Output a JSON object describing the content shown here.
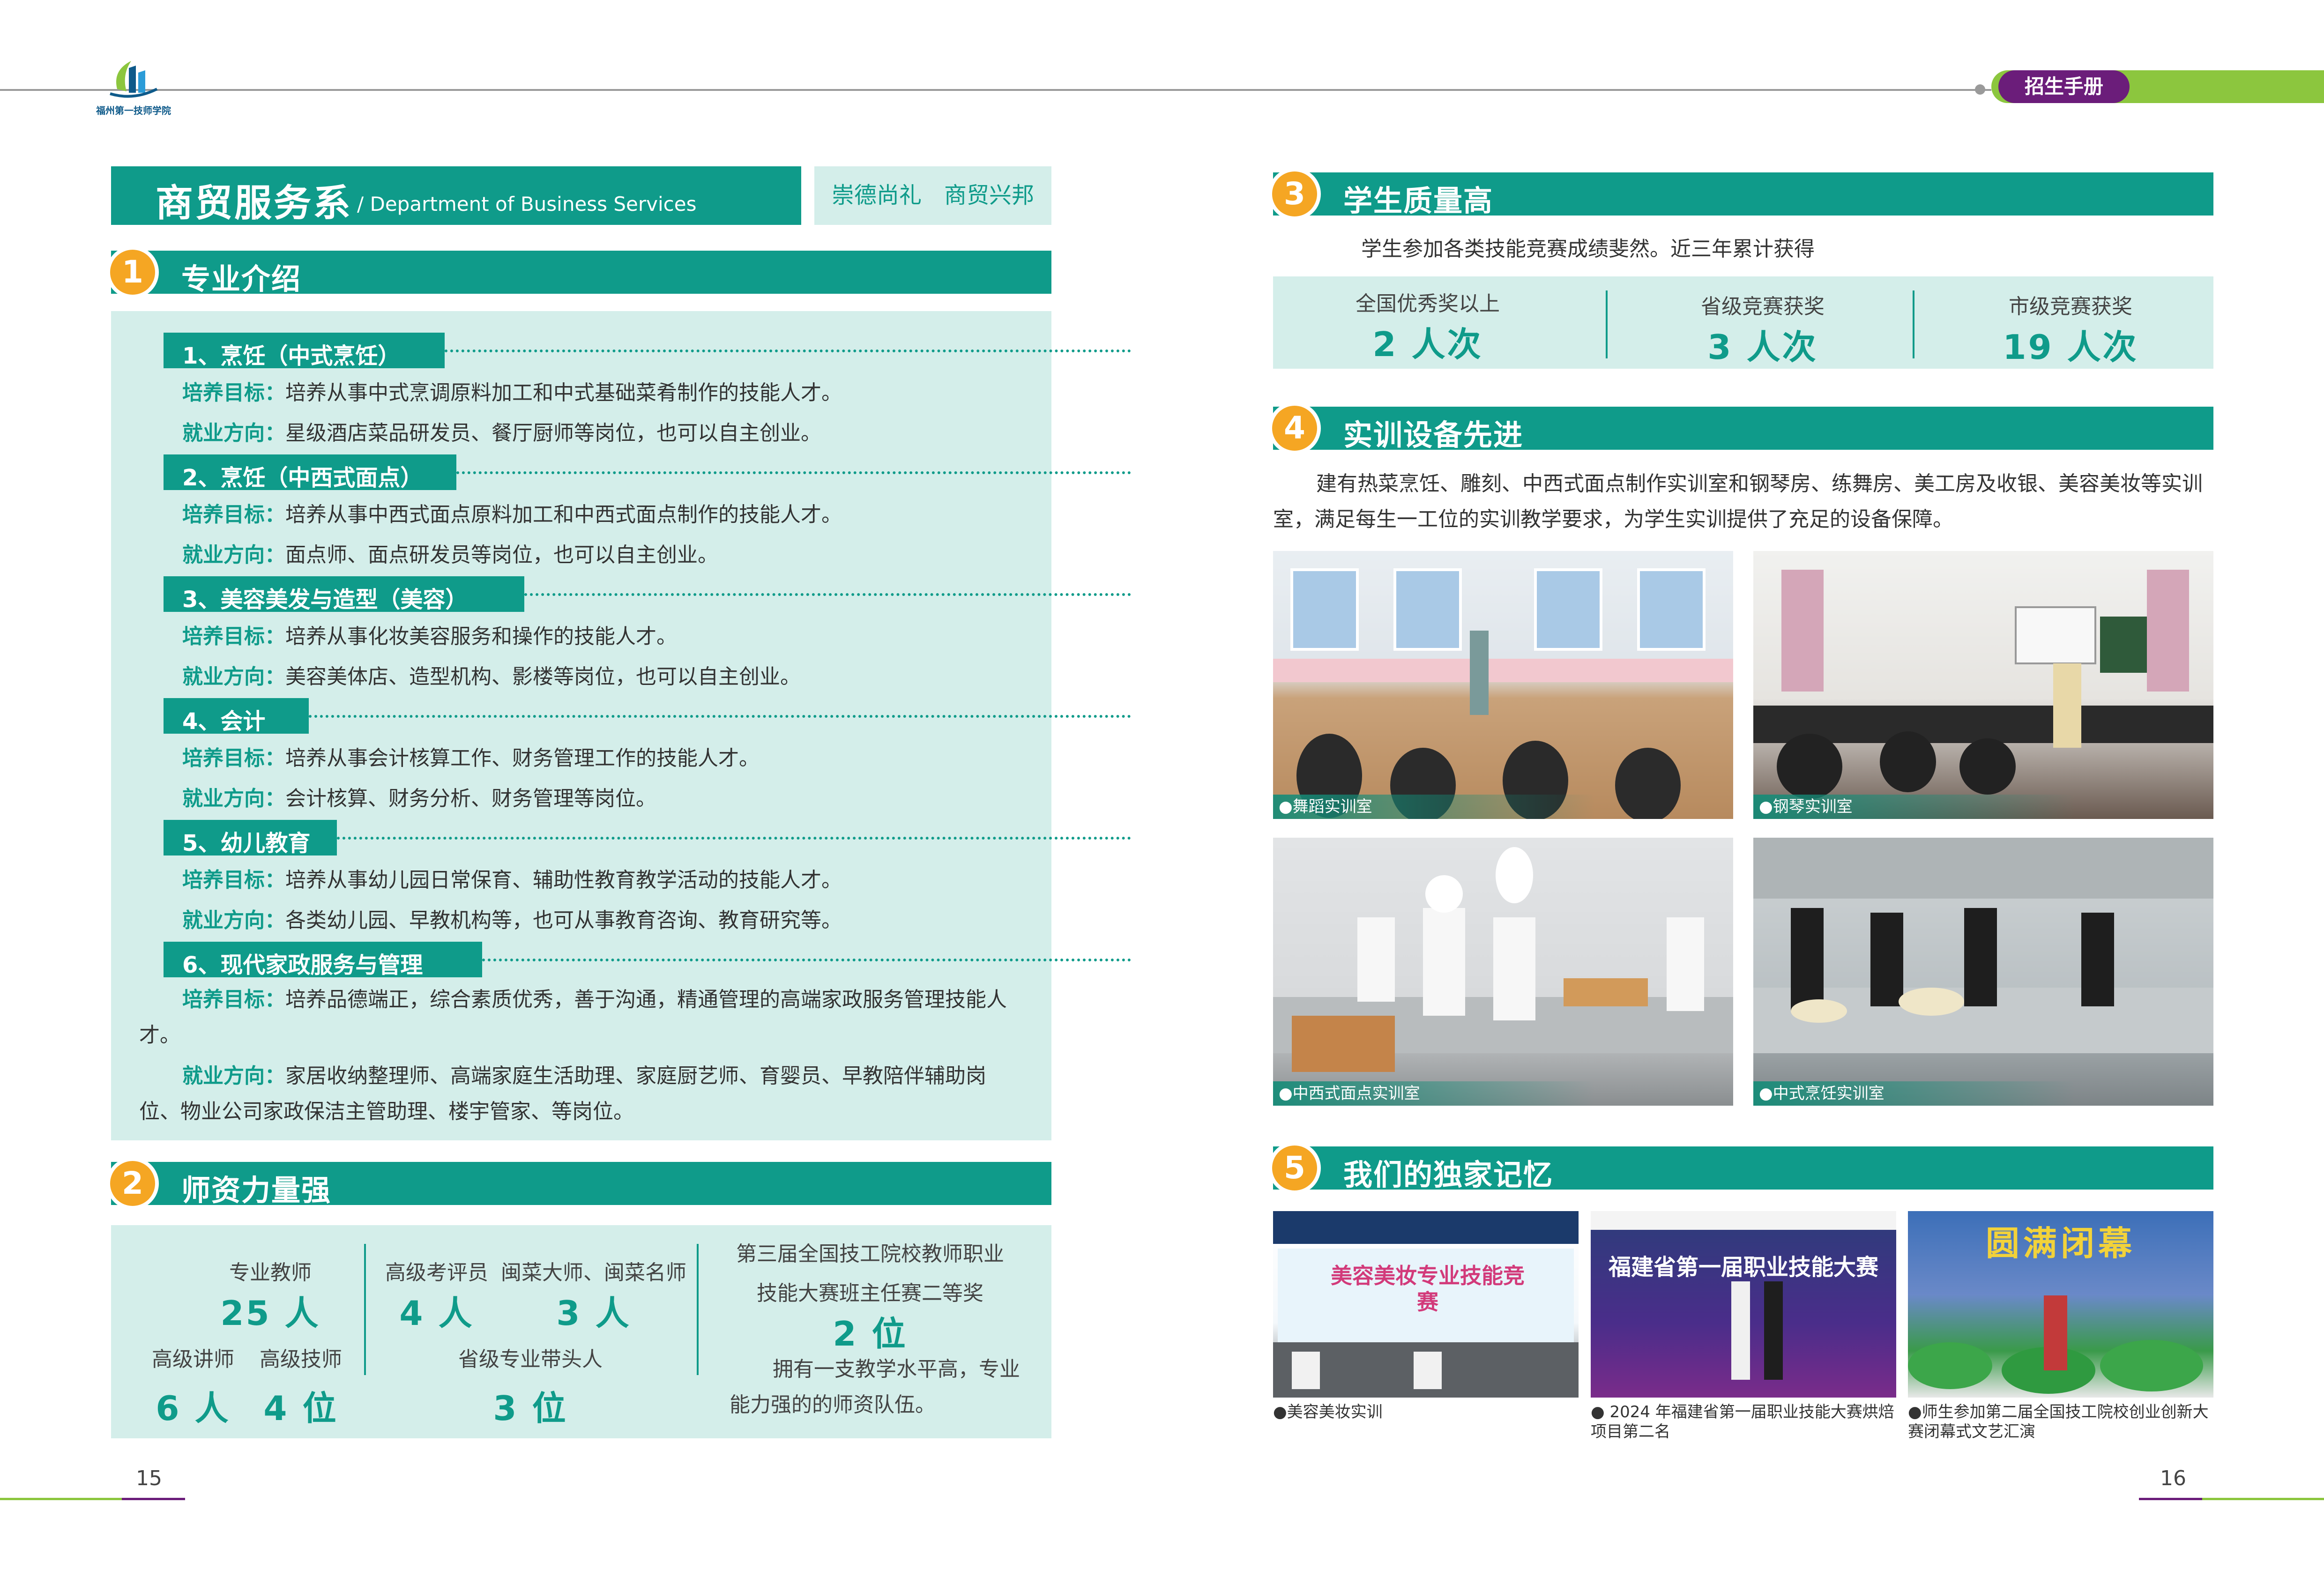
{
  "header": {
    "logo_text": "福州第一技师学院",
    "handbook_label": "招生手册"
  },
  "pages": {
    "left": "15",
    "right": "16"
  },
  "department": {
    "title": "商贸服务系",
    "english": "/ Department of Business Services",
    "motto": "崇德尚礼　商贸兴邦"
  },
  "sections": [
    {
      "num": "1",
      "title": "专业介绍"
    },
    {
      "num": "2",
      "title": "师资力量强"
    },
    {
      "num": "3",
      "title": "学生质量高"
    },
    {
      "num": "4",
      "title": "实训设备先进"
    },
    {
      "num": "5",
      "title": "我们的独家记忆"
    }
  ],
  "labels": {
    "goal": "培养目标：",
    "career": "就业方向："
  },
  "majors": [
    {
      "title": "1、烹饪（中式烹饪）",
      "goal": "培养从事中式烹调原料加工和中式基础菜肴制作的技能人才。",
      "career": "星级酒店菜品研发员、餐厅厨师等岗位，也可以自主创业。"
    },
    {
      "title": "2、烹饪（中西式面点）",
      "goal": "培养从事中西式面点原料加工和中西式面点制作的技能人才。",
      "career": "面点师、面点研发员等岗位，也可以自主创业。"
    },
    {
      "title": "3、美容美发与造型（美容）",
      "goal": "培养从事化妆美容服务和操作的技能人才。",
      "career": "美容美体店、造型机构、影楼等岗位，也可以自主创业。"
    },
    {
      "title": "4、会计",
      "goal": "培养从事会计核算工作、财务管理工作的技能人才。",
      "career": "会计核算、财务分析、财务管理等岗位。"
    },
    {
      "title": "5、幼儿教育",
      "goal": "培养从事幼儿园日常保育、辅助性教育教学活动的技能人才。",
      "career": "各类幼儿园、早教机构等，也可从事教育咨询、教育研究等。"
    },
    {
      "title": "6、现代家政服务与管理",
      "goal": "培养品德端正，综合素质优秀，善于沟通，精通管理的高端家政服务管理技能人才。",
      "career": "家居收纳整理师、高端家庭生活助理、家庭厨艺师、育婴员、早教陪伴辅助岗位、物业公司家政保洁主管助理、楼宇管家、等岗位。"
    }
  ],
  "teachers": {
    "professional_label": "专业教师",
    "professional_value": "25 人",
    "senior_lecturer_label": "高级讲师",
    "senior_lecturer_value": "6 人",
    "senior_tech_label": "高级技师",
    "senior_tech_value": "4 位",
    "examiner_label": "高级考评员",
    "examiner_value": "4 人",
    "chef_label": "闽菜大师、闽菜名师",
    "chef_value": "3 人",
    "leader_label": "省级专业带头人",
    "leader_value": "3 位",
    "award_line1": "第三届全国技工院校教师职业",
    "award_line2": "技能大赛班主任赛二等奖",
    "award_value": "2 位",
    "summary": "拥有一支教学水平高，专业能力强的的师资队伍。"
  },
  "quality": {
    "intro": "学生参加各类技能竞赛成绩斐然。近三年累计获得",
    "stats": [
      {
        "label": "全国优秀奖以上",
        "value": "2 人次"
      },
      {
        "label": "省级竞赛获奖",
        "value": "3 人次"
      },
      {
        "label": "市级竞赛获奖",
        "value": "19 人次"
      }
    ]
  },
  "facilities": {
    "intro": "建有热菜烹饪、雕刻、中西式面点制作实训室和钢琴房、练舞房、美工房及收银、美容美妆等实训室，满足每生一工位的实训教学要求，为学生实训提供了充足的设备保障。",
    "photos": [
      {
        "caption": "●舞蹈实训室"
      },
      {
        "caption": "●钢琴实训室"
      },
      {
        "caption": "●中西式面点实训室"
      },
      {
        "caption": "●中式烹饪实训室"
      }
    ]
  },
  "memories": [
    {
      "caption": "●美容美妆实训",
      "sign": "美容美妆专业技能竞赛"
    },
    {
      "caption": "● 2024 年福建省第一届职业技能大赛烘焙项目第二名",
      "sign": "福建省第一届职业技能大赛"
    },
    {
      "caption": "●师生参加第二届全国技工院校创业创新大赛闭幕式文艺汇演",
      "sign": "圆满闭幕"
    }
  ],
  "colors": {
    "teal": "#0f9b8a",
    "mint": "#d4eeea",
    "orange": "#f5a623",
    "purple": "#6b1d7a",
    "green": "#8cc63e"
  }
}
